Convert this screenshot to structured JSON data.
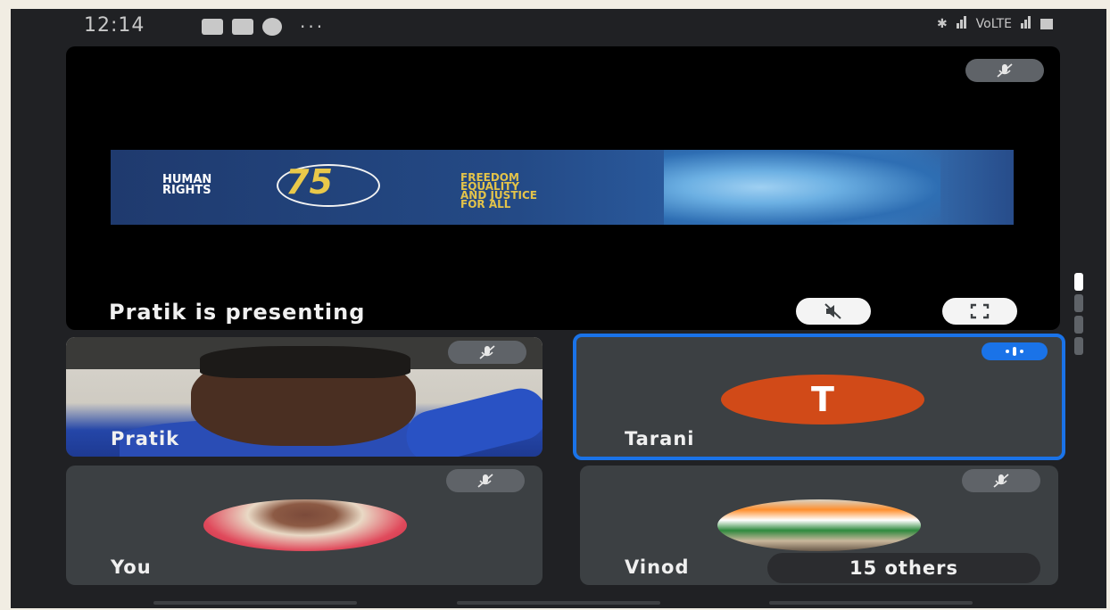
{
  "status_bar": {
    "time": "12:14",
    "more": "···",
    "network": "VoLTE"
  },
  "presentation": {
    "banner": {
      "org_line1": "HUMAN",
      "org_line2": "RIGHTS",
      "number": "75",
      "slogan_line1": "FREEDOM",
      "slogan_line2": "EQUALITY",
      "slogan_line3": "AND JUSTICE",
      "slogan_line4": "FOR ALL"
    },
    "label": "Pratik is presenting",
    "mute_icon": "mic-off-icon",
    "mute_presentation_icon": "volume-off-icon",
    "fullscreen_icon": "fullscreen-icon"
  },
  "participants": [
    {
      "name": "Pratik",
      "type": "video",
      "muted": true
    },
    {
      "name": "Tarani",
      "type": "avatar",
      "initial": "T",
      "speaking": true,
      "avatar_color": "#d14a18"
    },
    {
      "name": "You",
      "type": "photo",
      "muted": true
    },
    {
      "name": "Vinod",
      "type": "photo",
      "muted": true
    }
  ],
  "others": {
    "label": "15 others"
  },
  "colors": {
    "background": "#202124",
    "tile": "#3c4043",
    "accent": "#1a73e8",
    "mute_pill": "#5f6368"
  }
}
